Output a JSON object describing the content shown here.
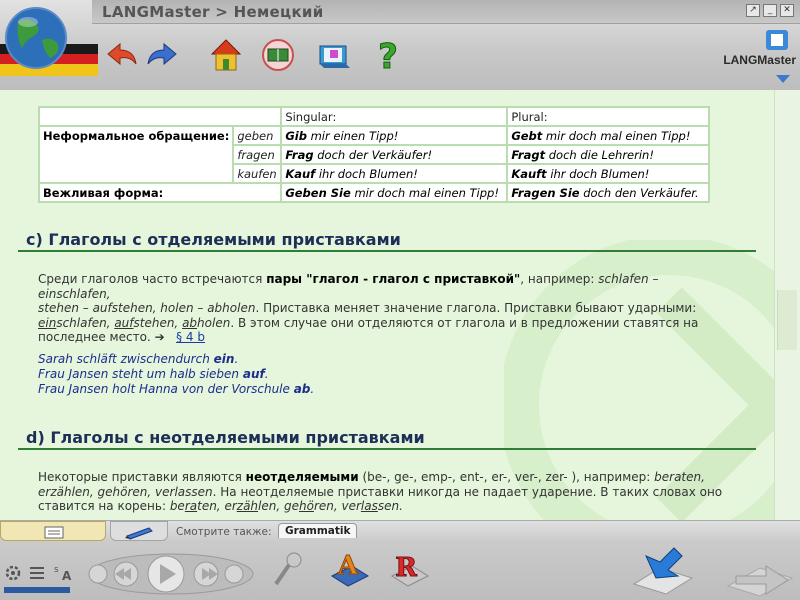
{
  "window": {
    "title": "LANGMaster > Немецкий",
    "btn_restore": "↗",
    "btn_minimize": "_",
    "btn_close": "✕",
    "brand": "LANGMaster"
  },
  "toolbar": {
    "icons": [
      "back-arrow-icon",
      "forward-arrow-icon",
      "home-icon",
      "dictionary-icon",
      "course-book-icon",
      "help-icon"
    ]
  },
  "table": {
    "header_singular": "Singular:",
    "header_plural": "Plural:",
    "informal_label": "Неформальное обращение:",
    "polite_label": "Вежливая форма:",
    "rows": [
      {
        "verb": "geben",
        "sg_bold": "Gib",
        "sg_rest": " mir einen Tipp!",
        "pl_bold": "Gebt",
        "pl_rest": " mir doch mal einen Tipp!"
      },
      {
        "verb": "fragen",
        "sg_bold": "Frag",
        "sg_rest": " doch der Verkäufer!",
        "pl_bold": "Fragt",
        "pl_rest": " doch die Lehrerin!"
      },
      {
        "verb": "kaufen",
        "sg_bold": "Kauf",
        "sg_rest": " ihr doch Blumen!",
        "pl_bold": "Kauft",
        "pl_rest": " ihr doch Blumen!"
      }
    ],
    "polite": {
      "sg_bold": "Geben Sie",
      "sg_rest": " mir doch mal einen Tipp!",
      "pl_bold": "Fragen Sie",
      "pl_rest": " doch den Verkäufer."
    }
  },
  "section_c": {
    "title": "с) Глаголы с отделяемыми приставками",
    "p1_a": "Среди глаголов часто встречаются ",
    "p1_b": "пары \"глагол - глагол с приставкой\"",
    "p1_c": ", например: ",
    "p1_d": "schlafen – einschlafen,",
    "p2_a": "stehen – aufstehen, holen – abholen",
    "p2_b": ". Приставка меняет значение глагола. Приставки бывают ударными:",
    "p3_u1": "ein",
    "p3_r1": "schlafen, ",
    "p3_u2": "auf",
    "p3_r2": "stehen, ",
    "p3_u3": "ab",
    "p3_r3": "holen",
    "p3_rest": ". В этом случае они отделяются от глагола и в предложении ставятся на",
    "p4": "последнее место.",
    "p4_arrow": "➔",
    "p4_link": "§ 4 b",
    "examples": [
      {
        "text": "Sarah schläft zwischendurch ",
        "bold": "ein",
        "end": "."
      },
      {
        "text": "Frau Jansen steht um halb sieben ",
        "bold": "auf",
        "end": "."
      },
      {
        "text": "Frau Jansen holt Hanna von der Vorschule ",
        "bold": "ab",
        "end": "."
      }
    ]
  },
  "section_d": {
    "title": "d) Глаголы с неотделяемыми приставками",
    "p1_a": "Некоторые приставки являются ",
    "p1_b": "неотделяемыми",
    "p1_c": " (be-, ge-, emp-, ent-, er-, ver-, zer- ), например: ",
    "p1_d": "beraten,",
    "p2_a": "erzählen, gehören, verlassen",
    "p2_b": ". На неотделяемые приставки никогда не падает ударение. В таких словах оно",
    "p3_a": "ставится на корень: ",
    "p3_w1a": "be",
    "p3_w1b": "ra",
    "p3_w1c": "ten, ",
    "p3_w2a": "er",
    "p3_w2b": "zäh",
    "p3_w2c": "len, ",
    "p3_w3a": "ge",
    "p3_w3b": "hö",
    "p3_w3c": "ren, ",
    "p3_w4a": "ver",
    "p3_w4b": "las",
    "p3_w4c": "sen."
  },
  "bottom": {
    "see_also_label": "Смотрите также:",
    "see_also_tab": "Grammatik"
  }
}
